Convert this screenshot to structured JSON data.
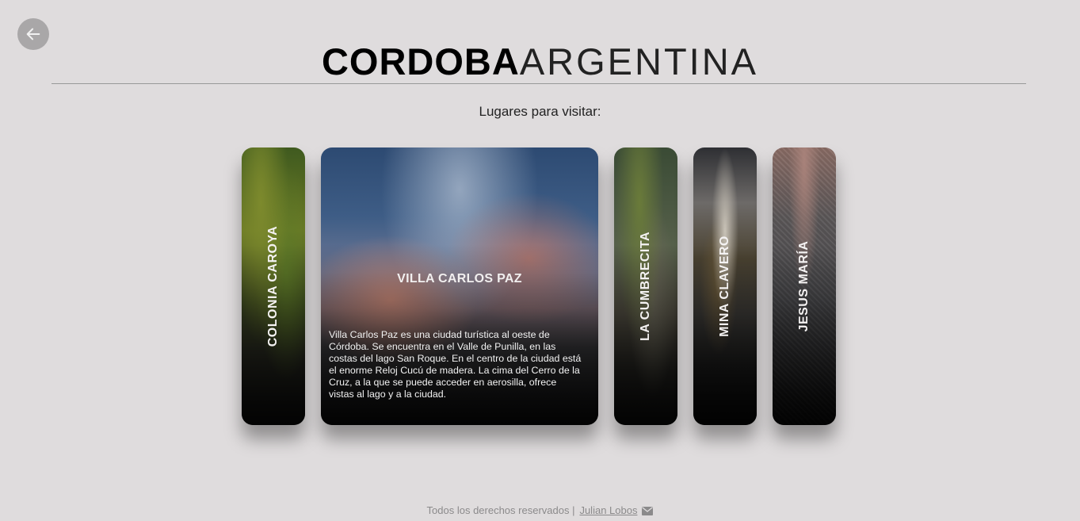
{
  "header": {
    "title_bold": "CORDOBA",
    "title_light": "ARGENTINA",
    "subtitle": "Lugares para visitar:"
  },
  "back": {
    "icon": "arrow-left-icon"
  },
  "cards": [
    {
      "label": "COLONIA CAROYA",
      "active": false
    },
    {
      "label": "VILLA CARLOS PAZ",
      "active": true,
      "description": "Villa Carlos Paz es una ciudad turística al oeste de Córdoba. Se encuentra en el Valle de Punilla, en las costas del lago San Roque. En el centro de la ciudad está el enorme Reloj Cucú de madera. La cima del Cerro de la Cruz, a la que se puede acceder en aerosilla, ofrece vistas al lago y a la ciudad."
    },
    {
      "label": "LA CUMBRECITA",
      "active": false
    },
    {
      "label": "MINA CLAVERO",
      "active": false
    },
    {
      "label": "JESUS MARÍA",
      "active": false
    }
  ],
  "footer": {
    "text": "Todos los derechos reservados |",
    "link": "Julian Lobos",
    "icon": "envelope-icon"
  }
}
